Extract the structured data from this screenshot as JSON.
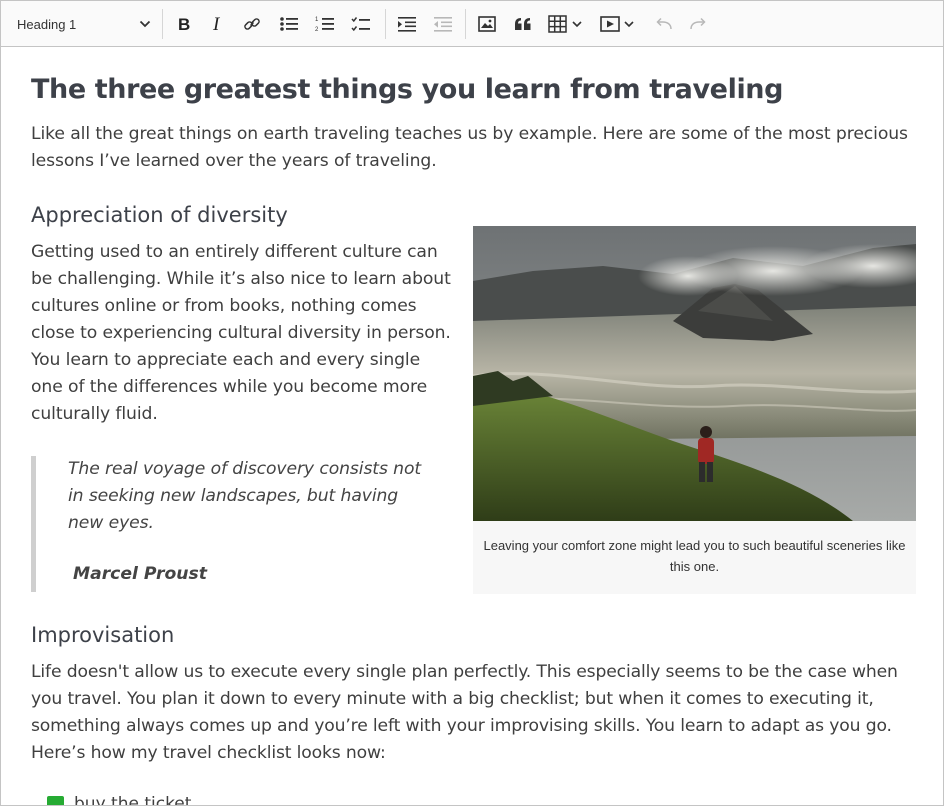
{
  "toolbar": {
    "heading_select": "Heading 1"
  },
  "document": {
    "title": "The three greatest things you learn from traveling",
    "intro": "Like all the great things on earth traveling teaches us by example. Here are some of the most precious lessons I’ve learned over the years of traveling.",
    "section1_heading": "Appreciation of diversity",
    "section1_paragraph": "Getting used to an entirely different culture can be challenging. While it’s also nice to learn about cultures online or from books, nothing comes close to experiencing cultural diversity in person. You learn to appreciate each and every single one of the differences while you become more culturally fluid.",
    "quote_text": "The real voyage of discovery consists not in seeking new landscapes, but having new eyes.",
    "quote_author": "Marcel Proust",
    "figure_caption": "Leaving your comfort zone might lead you to such beautiful sceneries like this one.",
    "section2_heading": "Improvisation",
    "section2_paragraph": "Life doesn't allow us to execute every single plan perfectly. This especially seems to be the case when you travel. You plan it down to every minute with a big checklist; but when it comes to executing it, something always comes up and you’re left with your improvising skills. You learn to adapt as you go. Here’s how my travel checklist looks now:",
    "checklist": [
      {
        "label": "buy the ticket",
        "checked": true
      }
    ]
  },
  "colors": {
    "checkbox_checked": "#26ab33",
    "heading_text": "#3d4149",
    "toolbar_bg": "#fafafa"
  }
}
